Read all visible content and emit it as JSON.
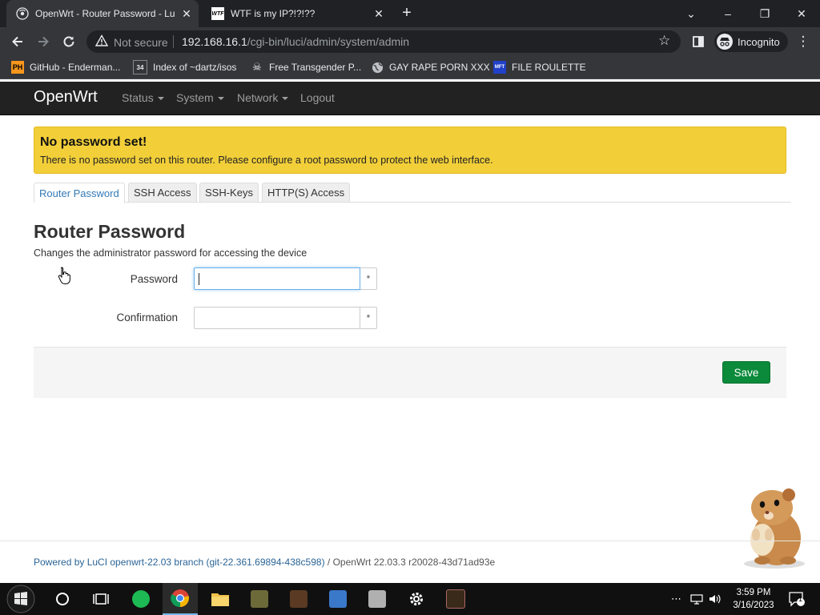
{
  "browser": {
    "tabs": [
      {
        "title": "OpenWrt - Router Password - Lu",
        "favicon": "openwrt-favicon"
      },
      {
        "title": "WTF is my IP?!?!??",
        "favicon": "wtf-favicon"
      }
    ],
    "new_tab": "+",
    "window_controls": {
      "dropdown": "⌄",
      "minimize": "–",
      "restore": "❐",
      "close": "✕"
    },
    "omnibox": {
      "security": "Not secure",
      "host": "192.168.16.1",
      "path": "/cgi-bin/luci/admin/system/admin"
    },
    "profile_label": "Incognito",
    "bookmarks": [
      {
        "label": "GitHub - Enderman...",
        "icon": "PH"
      },
      {
        "label": "Index of ~dartz/isos",
        "icon": "34"
      },
      {
        "label": "Free Transgender P...",
        "icon": "skull"
      },
      {
        "label": "GAY RAPE PORN XXX",
        "icon": "globe"
      },
      {
        "label": "FILE ROULETTE",
        "icon": "MFT"
      }
    ]
  },
  "navbar": {
    "brand": "OpenWrt",
    "items": [
      {
        "label": "Status",
        "dropdown": true
      },
      {
        "label": "System",
        "dropdown": true
      },
      {
        "label": "Network",
        "dropdown": true
      },
      {
        "label": "Logout",
        "dropdown": false
      }
    ]
  },
  "alert": {
    "title": "No password set!",
    "text": "There is no password set on this router. Please configure a root password to protect the web interface."
  },
  "tabs": [
    "Router Password",
    "SSH Access",
    "SSH-Keys",
    "HTTP(S) Access"
  ],
  "section": {
    "title": "Router Password",
    "description": "Changes the administrator password for accessing the device",
    "fields": [
      {
        "label": "Password",
        "value": ""
      },
      {
        "label": "Confirmation",
        "value": ""
      }
    ],
    "reveal_symbol": "*",
    "save_label": "Save"
  },
  "footer": {
    "link": "Powered by LuCI openwrt-22.03 branch (git-22.361.69894-438c598)",
    "text": " / OpenWrt 22.03.3 r20028-43d71ad93e"
  },
  "taskbar": {
    "clock_time": "3:59 PM",
    "clock_date": "3/16/2023",
    "notification_count": "1"
  },
  "colors": {
    "navbar_bg": "#222222",
    "alert_bg": "#f2cf39",
    "save_bg": "#0a8a3a",
    "link": "#2a6496"
  }
}
